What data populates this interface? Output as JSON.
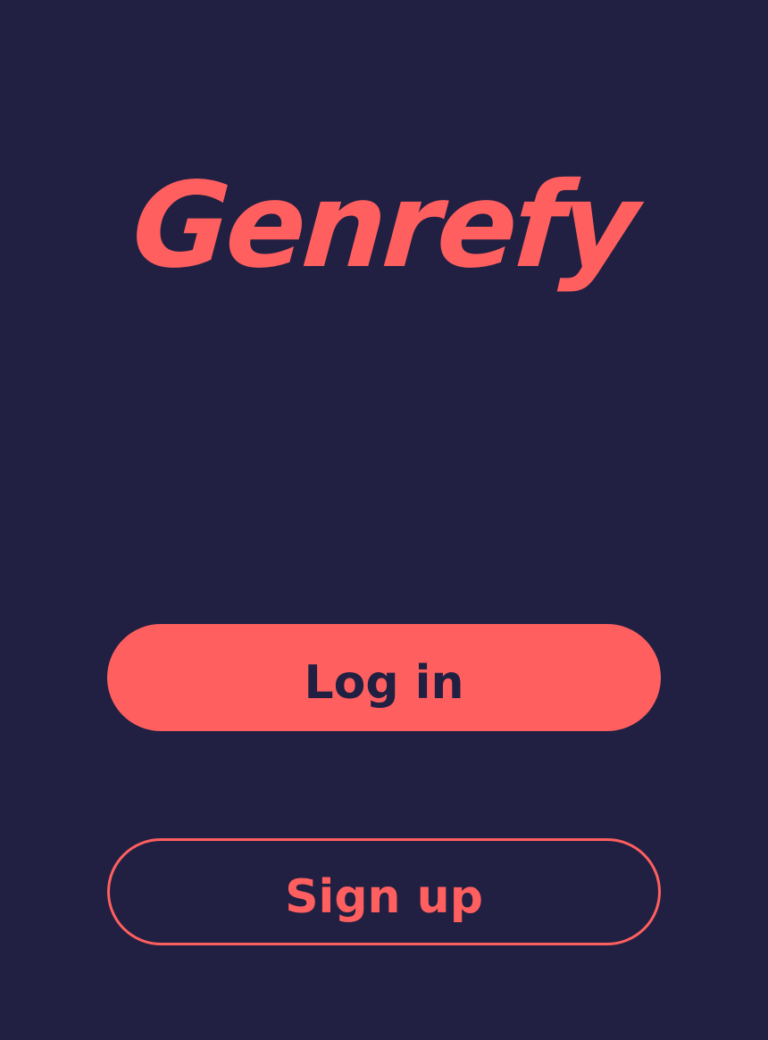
{
  "app": {
    "logo_text": "Genrefy"
  },
  "actions": {
    "login_label": "Log in",
    "signup_label": "Sign up"
  },
  "colors": {
    "background": "#212042",
    "accent": "#ff5f5f"
  }
}
